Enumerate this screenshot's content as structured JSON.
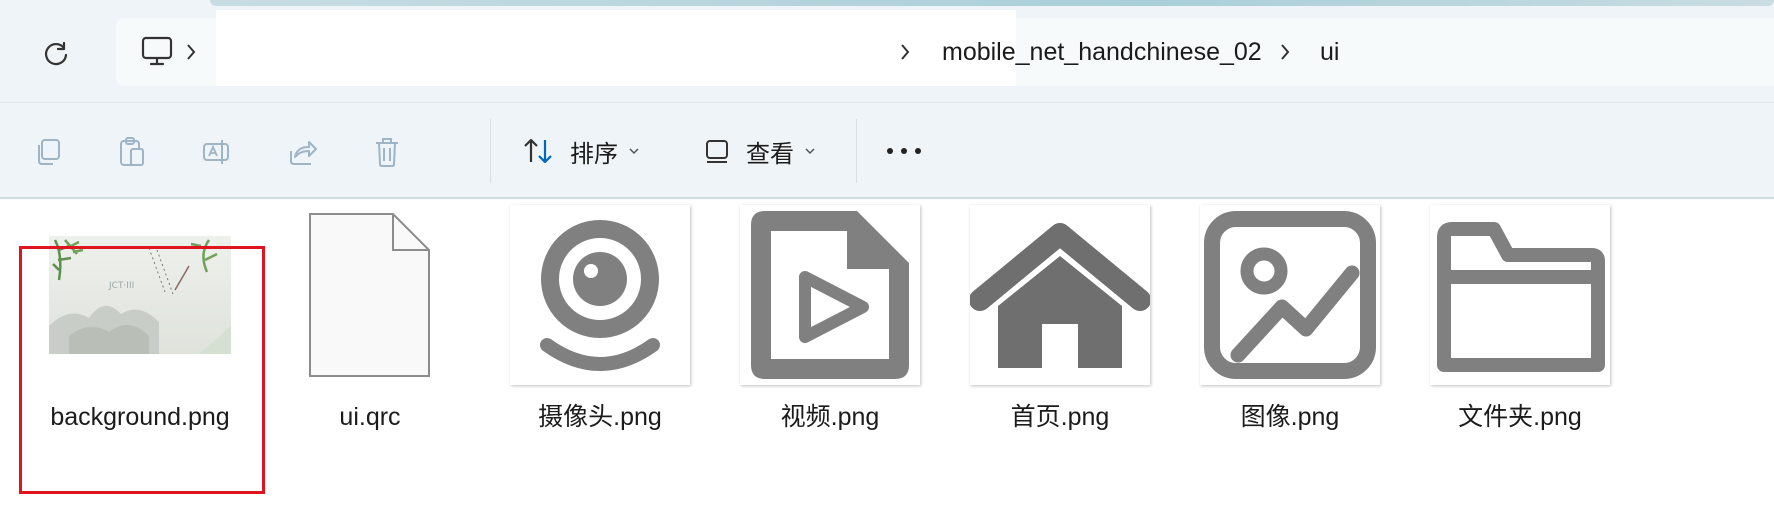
{
  "address_bar": {
    "crumbs": [
      "mobile_net_handchinese_02",
      "ui"
    ]
  },
  "command_bar": {
    "sort_label": "排序",
    "view_label": "查看"
  },
  "files": [
    {
      "name": "background.png",
      "icon": "image-thumbnail"
    },
    {
      "name": "ui.qrc",
      "icon": "blank-file-icon"
    },
    {
      "name": "摄像头.png",
      "icon": "webcam-icon"
    },
    {
      "name": "视频.png",
      "icon": "video-file-icon"
    },
    {
      "name": "首页.png",
      "icon": "home-icon"
    },
    {
      "name": "图像.png",
      "icon": "image-icon"
    },
    {
      "name": "文件夹.png",
      "icon": "folder-icon"
    }
  ],
  "colors": {
    "selection_border": "#e0141e",
    "icon_gray": "#808080",
    "chrome_bg": "#eef4f7",
    "accent_blue": "#0067c0"
  }
}
